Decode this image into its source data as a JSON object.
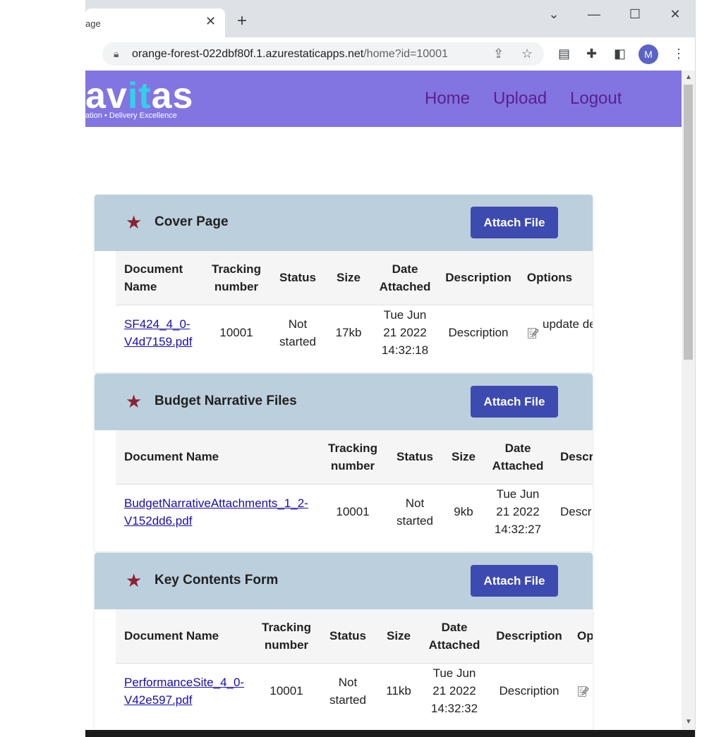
{
  "browser": {
    "tab_title": "age",
    "tab_close": "✕",
    "new_tab": "+",
    "url_host": "orange-forest-022dbf80f.1.azurestaticapps.net",
    "url_path": "/home?id=10001",
    "avatar_initial": "M"
  },
  "header": {
    "logo_a": "av",
    "logo_t": "it",
    "logo_b": "as",
    "tagline": "ation • Delivery Excellence",
    "nav": [
      "Home",
      "Upload",
      "Logout"
    ]
  },
  "sections": [
    {
      "title": "Cover Page",
      "attach_label": "Attach File",
      "headers": [
        "Document Name",
        "Tracking number",
        "Status",
        "Size",
        "Date Attached",
        "Description",
        "Options"
      ],
      "row": {
        "doc": "SF424_4_0-V4d7159.pdf",
        "tracking": "10001",
        "status": "Not started",
        "size": "17kb",
        "date": "Tue Jun 21 2022 14:32:18",
        "description": "Description",
        "option": "update description"
      }
    },
    {
      "title": "Budget Narrative Files",
      "attach_label": "Attach File",
      "headers": [
        "Document Name",
        "Tracking number",
        "Status",
        "Size",
        "Date Attached",
        "Descr"
      ],
      "row": {
        "doc": "BudgetNarrativeAttachments_1_2-V152dd6.pdf",
        "tracking": "10001",
        "status": "Not started",
        "size": "9kb",
        "date": "Tue Jun 21 2022 14:32:27",
        "description": "Descr"
      }
    },
    {
      "title": "Key Contents Form",
      "attach_label": "Attach File",
      "headers": [
        "Document Name",
        "Tracking number",
        "Status",
        "Size",
        "Date Attached",
        "Description",
        "Op"
      ],
      "row": {
        "doc": "PerformanceSite_4_0-V42e597.pdf",
        "tracking": "10001",
        "status": "Not started",
        "size": "11kb",
        "date": "Tue Jun 21 2022 14:32:32",
        "description": "Description"
      }
    }
  ],
  "colors": {
    "header_bg": "#8275e1",
    "nav_text": "#5a1f8f",
    "section_head_bg": "#bccfdd",
    "attach_button": "#3d4aaf",
    "star": "#8b2232"
  }
}
